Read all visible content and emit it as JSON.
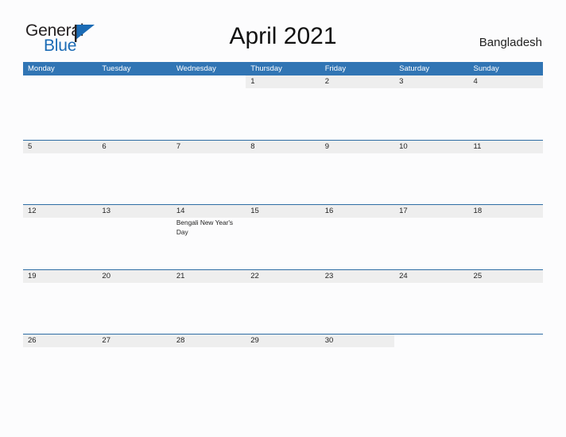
{
  "brand": {
    "name_part1": "General",
    "name_part2": "Blue",
    "flag_color": "#1b6bb5"
  },
  "header": {
    "title": "April 2021",
    "country": "Bangladesh"
  },
  "theme": {
    "header_blue": "#3175b4",
    "rule_blue": "#2e6da4",
    "band_gray": "#eeeeee",
    "page_background": "#fcfcfd"
  },
  "calendar": {
    "day_names": [
      "Monday",
      "Tuesday",
      "Wednesday",
      "Thursday",
      "Friday",
      "Saturday",
      "Sunday"
    ],
    "weeks": [
      [
        {
          "num": "",
          "event": ""
        },
        {
          "num": "",
          "event": ""
        },
        {
          "num": "",
          "event": ""
        },
        {
          "num": "1",
          "event": ""
        },
        {
          "num": "2",
          "event": ""
        },
        {
          "num": "3",
          "event": ""
        },
        {
          "num": "4",
          "event": ""
        }
      ],
      [
        {
          "num": "5",
          "event": ""
        },
        {
          "num": "6",
          "event": ""
        },
        {
          "num": "7",
          "event": ""
        },
        {
          "num": "8",
          "event": ""
        },
        {
          "num": "9",
          "event": ""
        },
        {
          "num": "10",
          "event": ""
        },
        {
          "num": "11",
          "event": ""
        }
      ],
      [
        {
          "num": "12",
          "event": ""
        },
        {
          "num": "13",
          "event": ""
        },
        {
          "num": "14",
          "event": "Bengali New Year's Day"
        },
        {
          "num": "15",
          "event": ""
        },
        {
          "num": "16",
          "event": ""
        },
        {
          "num": "17",
          "event": ""
        },
        {
          "num": "18",
          "event": ""
        }
      ],
      [
        {
          "num": "19",
          "event": ""
        },
        {
          "num": "20",
          "event": ""
        },
        {
          "num": "21",
          "event": ""
        },
        {
          "num": "22",
          "event": ""
        },
        {
          "num": "23",
          "event": ""
        },
        {
          "num": "24",
          "event": ""
        },
        {
          "num": "25",
          "event": ""
        }
      ],
      [
        {
          "num": "26",
          "event": ""
        },
        {
          "num": "27",
          "event": ""
        },
        {
          "num": "28",
          "event": ""
        },
        {
          "num": "29",
          "event": ""
        },
        {
          "num": "30",
          "event": ""
        },
        {
          "num": "",
          "event": ""
        },
        {
          "num": "",
          "event": ""
        }
      ]
    ]
  }
}
